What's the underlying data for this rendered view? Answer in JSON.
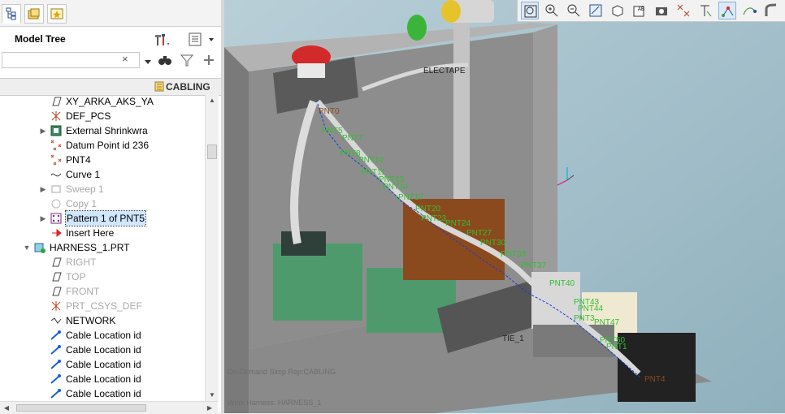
{
  "model_tree": {
    "title": "Model Tree",
    "search": {
      "value": "",
      "placeholder": "",
      "clear_symbol": "×"
    },
    "column_badge": "CABLING",
    "rows": [
      {
        "label": "XY_ARKA_AKS_YA",
        "icon": "datum-plane-icon",
        "dim": false,
        "expander": ""
      },
      {
        "label": "DEF_PCS",
        "icon": "csys-icon",
        "dim": false,
        "expander": ""
      },
      {
        "label": "External Shrinkwra",
        "icon": "shrinkwrap-icon",
        "dim": false,
        "expander": "▶"
      },
      {
        "label": "Datum Point id 236",
        "icon": "datum-point-icon",
        "dim": false,
        "expander": ""
      },
      {
        "label": "PNT4",
        "icon": "datum-point-icon",
        "dim": false,
        "expander": ""
      },
      {
        "label": "Curve 1",
        "icon": "curve-icon",
        "dim": false,
        "expander": ""
      },
      {
        "label": "Sweep 1",
        "icon": "sweep-icon",
        "dim": true,
        "expander": "▶"
      },
      {
        "label": "Copy 1",
        "icon": "copy-icon",
        "dim": true,
        "expander": ""
      },
      {
        "label": "Pattern 1 of PNT5",
        "icon": "pattern-icon",
        "dim": false,
        "expander": "▶",
        "selected": true
      },
      {
        "label": "Insert Here",
        "icon": "insert-arrow-icon",
        "dim": false,
        "expander": ""
      },
      {
        "label": "HARNESS_1.PRT",
        "icon": "part-icon",
        "dim": false,
        "expander": "▼",
        "indent": 0
      },
      {
        "label": "RIGHT",
        "icon": "datum-plane-icon",
        "dim": true,
        "expander": ""
      },
      {
        "label": "TOP",
        "icon": "datum-plane-icon",
        "dim": true,
        "expander": ""
      },
      {
        "label": "FRONT",
        "icon": "datum-plane-icon",
        "dim": true,
        "expander": ""
      },
      {
        "label": "PRT_CSYS_DEF",
        "icon": "csys-icon",
        "dim": true,
        "expander": ""
      },
      {
        "label": "NETWORK",
        "icon": "network-icon",
        "dim": false,
        "expander": ""
      },
      {
        "label": "Cable Location id",
        "icon": "cable-location-icon",
        "dim": false,
        "expander": ""
      },
      {
        "label": "Cable Location id",
        "icon": "cable-location-icon",
        "dim": false,
        "expander": ""
      },
      {
        "label": "Cable Location id",
        "icon": "cable-location-icon",
        "dim": false,
        "expander": ""
      },
      {
        "label": "Cable Location id",
        "icon": "cable-location-icon",
        "dim": false,
        "expander": ""
      },
      {
        "label": "Cable Location id",
        "icon": "cable-location-icon",
        "dim": false,
        "expander": ""
      }
    ]
  },
  "viewport": {
    "status_rep": "On-Demand Simp Rep:CABLING",
    "status_harness": "Work Harness: HARNESS_1",
    "labels": {
      "ellectape": "ELECTAPE",
      "tie": "TIE_1",
      "pnt4": "PNT4",
      "pnt0": "PNT0"
    },
    "point_labels": [
      "PNT5",
      "PNT7",
      "PNT8",
      "PNT10",
      "PNT11",
      "PNT13",
      "PNT14",
      "PNT17",
      "PNT20",
      "PNT23",
      "PNT24",
      "PNT27",
      "PNT30",
      "PNT33",
      "PNT37",
      "PNT40",
      "PNT43",
      "PNT44",
      "PNT47",
      "PNT50",
      "PNT3",
      "PNT1"
    ],
    "toolbar_icons": [
      "refit-icon",
      "zoom-in-icon",
      "zoom-out-icon",
      "repaint-icon",
      "display-style-icon",
      "saved-views-icon",
      "view-manager-icon",
      "datum-display-icon",
      "annotation-display-icon",
      "point-display-icon",
      "spin-center-icon",
      "cable-display-icon"
    ]
  },
  "colors": {
    "viewport_bg": "#a8bec9",
    "point_label": "#2fbf2f",
    "cable_path": "#1a3ad8",
    "enclosure": "#9a9a9a",
    "connector_green": "#4f9a6c",
    "relay_brown": "#8b4a1e"
  }
}
